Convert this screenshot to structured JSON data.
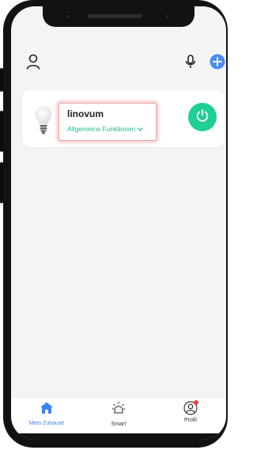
{
  "header": {
    "user_icon": "user-outline-icon",
    "mic_icon": "microphone-icon",
    "add_icon": "plus-circle-icon",
    "accent": "#4a8af4"
  },
  "device": {
    "icon": "light-bulb-icon",
    "name": "linovum",
    "function_label": "Allgemeine Funktionen",
    "dropdown_icon": "chevron-down-icon",
    "power_icon": "power-icon",
    "power_color": "#1fcf95",
    "function_color": "#1fb896"
  },
  "tabbar": {
    "tabs": [
      {
        "label": "Mein Zuhause",
        "icon": "home-icon",
        "active": true
      },
      {
        "label": "Smart",
        "icon": "sun-icon",
        "active": false
      },
      {
        "label": "Profil",
        "icon": "profile-icon",
        "active": false,
        "badge": true
      }
    ],
    "active_color": "#3c82f0",
    "badge_color": "#e84040"
  }
}
